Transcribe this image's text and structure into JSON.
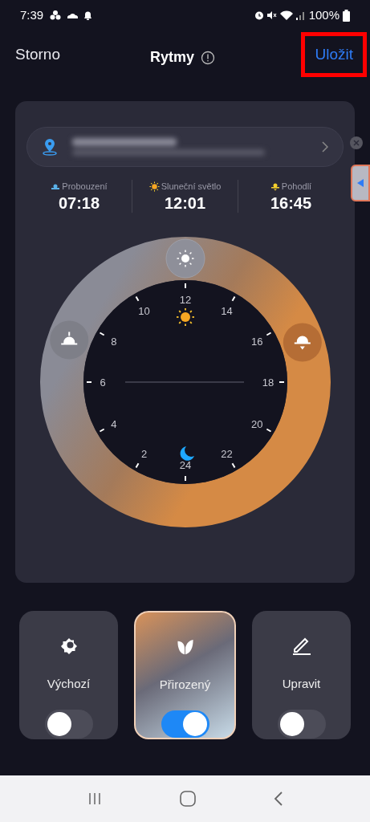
{
  "status_bar": {
    "time": "7:39",
    "battery": "100%"
  },
  "header": {
    "cancel": "Storno",
    "title": "Rytmy",
    "save": {
      "label": "Uložit",
      "highlighted": true
    }
  },
  "stats": [
    {
      "kind": "wake",
      "label": "Probouzení",
      "value": "07:18"
    },
    {
      "kind": "sun",
      "label": "Sluneční světlo",
      "value": "12:01"
    },
    {
      "kind": "dusk",
      "label": "Pohodlí",
      "value": "16:45"
    }
  ],
  "dial": {
    "hour_labels": [
      "12",
      "14",
      "16",
      "18",
      "20",
      "22",
      "24",
      "2",
      "4",
      "6",
      "8",
      "10"
    ]
  },
  "modes": [
    {
      "kind": "default",
      "label": "Výchozí",
      "selected": false,
      "on": false
    },
    {
      "kind": "natural",
      "label": "Přirozený",
      "selected": true,
      "on": true
    },
    {
      "kind": "edit",
      "label": "Upravit",
      "selected": false,
      "on": false
    }
  ]
}
